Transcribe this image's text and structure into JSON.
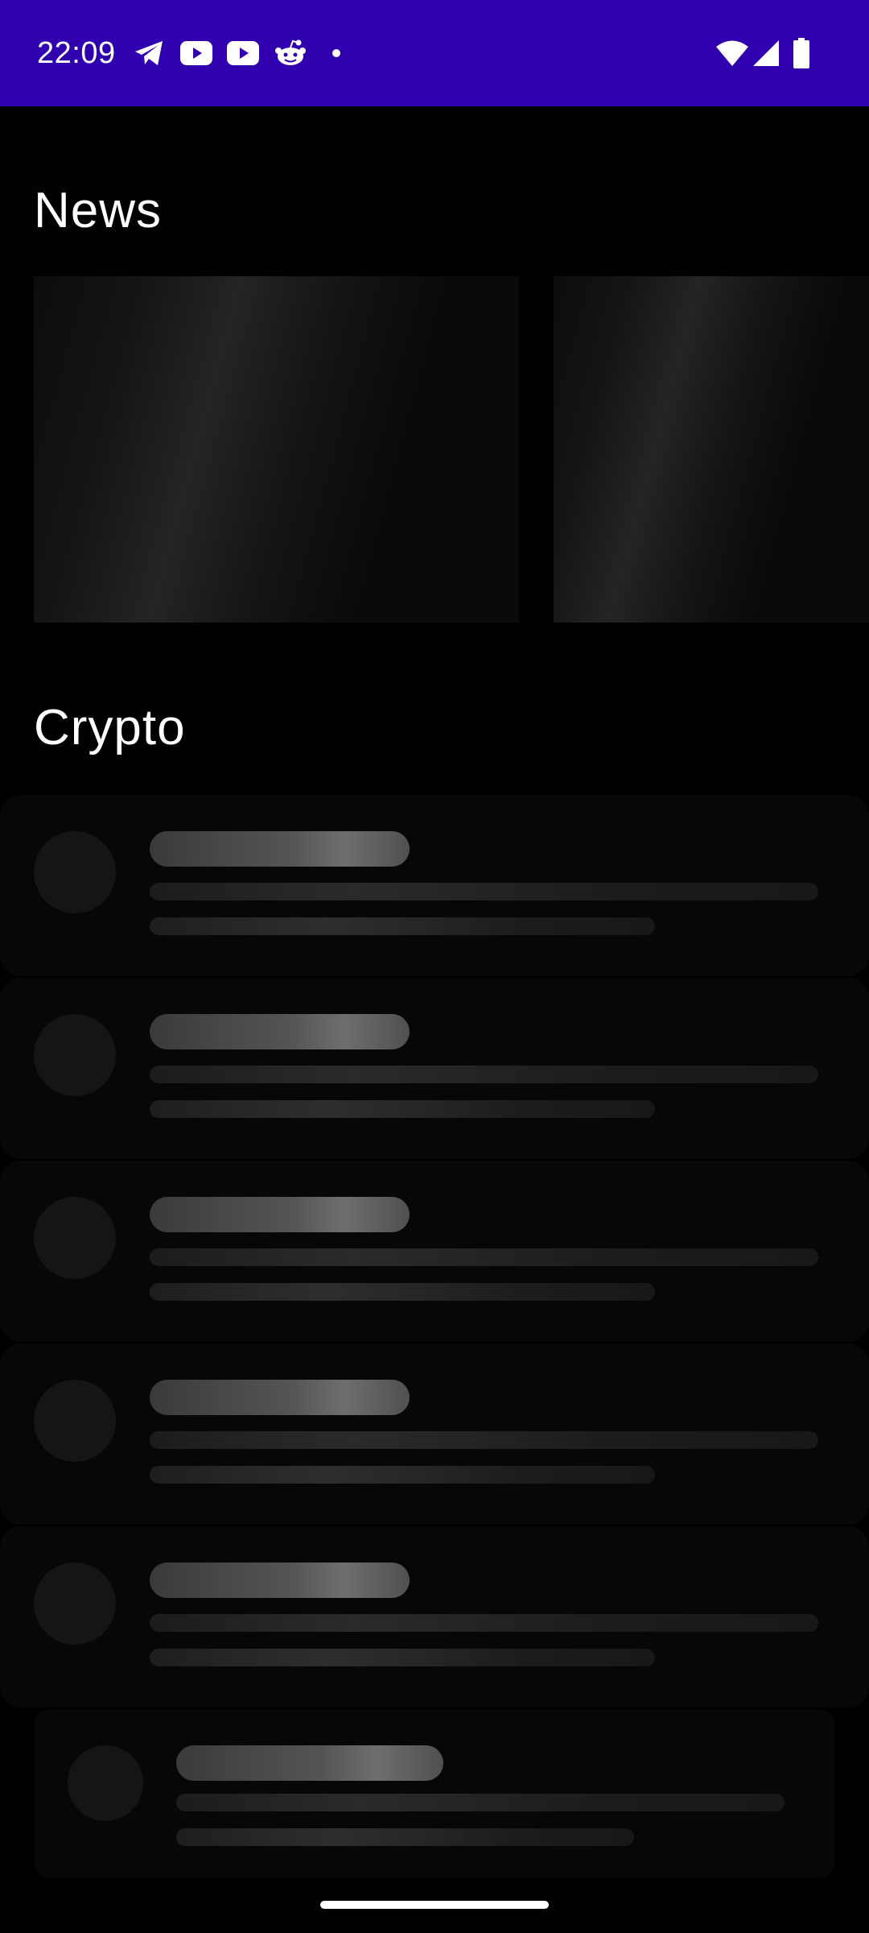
{
  "status_bar": {
    "time": "22:09",
    "background": "#3000AE",
    "notification_icons": [
      "telegram-icon",
      "youtube-icon",
      "youtube-icon",
      "reddit-icon",
      "more-notifications-dot-icon"
    ],
    "system_icons": [
      "wifi-icon",
      "cellular-signal-icon",
      "battery-icon"
    ]
  },
  "sections": {
    "news": {
      "title": "News"
    },
    "crypto": {
      "title": "Crypto"
    }
  },
  "news_placeholders": 2,
  "crypto_placeholders": 6,
  "colors": {
    "background": "#000000",
    "skeleton_card": "#070707",
    "skeleton_avatar": "#151515",
    "skeleton_bar": "#555555",
    "text": "#ffffff"
  }
}
